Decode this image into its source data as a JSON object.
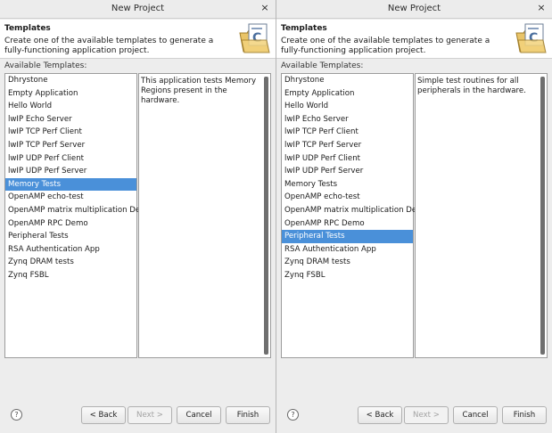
{
  "dialogs": [
    {
      "title": "New Project",
      "header_title": "Templates",
      "header_desc": "Create one of the available templates to generate a fully-functioning application project.",
      "available_label": "Available Templates:",
      "items": [
        "Dhrystone",
        "Empty Application",
        "Hello World",
        "lwIP Echo Server",
        "lwIP TCP Perf Client",
        "lwIP TCP Perf Server",
        "lwIP UDP Perf Client",
        "lwIP UDP Perf Server",
        "Memory Tests",
        "OpenAMP echo-test",
        "OpenAMP matrix multiplication Demo",
        "OpenAMP RPC Demo",
        "Peripheral Tests",
        "RSA Authentication App",
        "Zynq DRAM tests",
        "Zynq FSBL"
      ],
      "selected_item": "Memory Tests",
      "description": "This application tests Memory Regions present in the hardware.",
      "buttons": {
        "back": "< Back",
        "next": "Next >",
        "cancel": "Cancel",
        "finish": "Finish"
      },
      "help": "?",
      "close": "×"
    },
    {
      "title": "New Project",
      "header_title": "Templates",
      "header_desc": "Create one of the available templates to generate a fully-functioning application project.",
      "available_label": "Available Templates:",
      "items": [
        "Dhrystone",
        "Empty Application",
        "Hello World",
        "lwIP Echo Server",
        "lwIP TCP Perf Client",
        "lwIP TCP Perf Server",
        "lwIP UDP Perf Client",
        "lwIP UDP Perf Server",
        "Memory Tests",
        "OpenAMP echo-test",
        "OpenAMP matrix multiplication Demo",
        "OpenAMP RPC Demo",
        "Peripheral Tests",
        "RSA Authentication App",
        "Zynq DRAM tests",
        "Zynq FSBL"
      ],
      "selected_item": "Peripheral Tests",
      "description": "Simple test routines for all peripherals in the hardware.",
      "buttons": {
        "back": "< Back",
        "next": "Next >",
        "cancel": "Cancel",
        "finish": "Finish"
      },
      "help": "?",
      "close": "×"
    }
  ],
  "colors": {
    "selection": "#4a90d9",
    "dialog_bg": "#ededed"
  },
  "icons": {
    "header": "new-application-project-icon",
    "help": "help-icon",
    "close": "close-icon"
  }
}
